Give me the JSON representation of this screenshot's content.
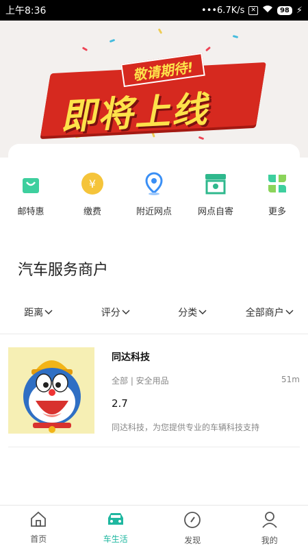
{
  "status_bar": {
    "time": "上午8:36",
    "network_speed": "•••6.7K/s",
    "sim_icon_text": "✕",
    "battery": "98"
  },
  "banner": {
    "subtitle": "敬请期待!",
    "title": "即将上线"
  },
  "quick_menu": [
    {
      "label": "邮特惠",
      "icon": "shopping-bag-icon",
      "color": "#3ecf9e"
    },
    {
      "label": "缴费",
      "icon": "yuan-coin-icon",
      "color": "#f5c43a"
    },
    {
      "label": "附近网点",
      "icon": "location-pin-icon",
      "color": "#3a8ff5"
    },
    {
      "label": "网点自寄",
      "icon": "store-icon",
      "color": "#2fb88d"
    },
    {
      "label": "更多",
      "icon": "more-grid-icon",
      "color": "#3ecf9e"
    }
  ],
  "section_title": "汽车服务商户",
  "filters": [
    {
      "label": "距离"
    },
    {
      "label": "评分"
    },
    {
      "label": "分类"
    },
    {
      "label": "全部商户"
    }
  ],
  "merchant": {
    "name": "同达科技",
    "category": "全部 | 安全用品",
    "distance": "51m",
    "rating": "2.7",
    "description": "同达科技，为您提供专业的车辆科技支持"
  },
  "bottom_nav": [
    {
      "label": "首页",
      "icon": "home-icon",
      "active": false
    },
    {
      "label": "车生活",
      "icon": "car-icon",
      "active": true
    },
    {
      "label": "发现",
      "icon": "compass-icon",
      "active": false
    },
    {
      "label": "我的",
      "icon": "user-icon",
      "active": false
    }
  ],
  "colors": {
    "accent": "#1fb7a0",
    "banner_red": "#d6291f",
    "banner_yellow": "#fde24a"
  }
}
